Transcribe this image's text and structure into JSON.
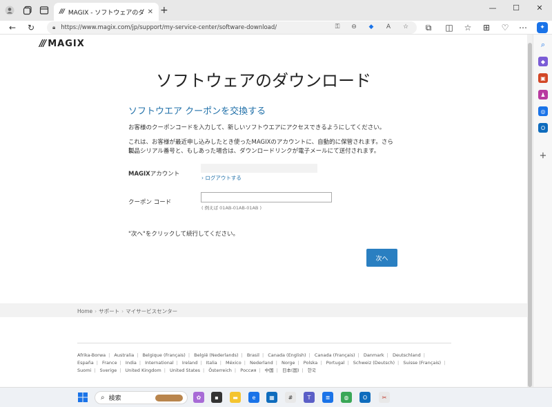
{
  "browser": {
    "tab_title": "MAGIX - ソフトウェアのダウンロード",
    "tab_favicon": "///",
    "url": "https://www.magix.com/jp/support/my-service-center/software-download/"
  },
  "page": {
    "logo": "MAGIX",
    "logo_mark": "///",
    "heading": "ソフトウェアのダウンロード",
    "subheading": "ソフトウエア クーポンを交換する",
    "intro": "お客様のクーポンコードを入力して、新しいソフトウエアにアクセスできるようにしてください。",
    "note_line1": "これは、お客様が最近申し込みしたとき使ったMAGIXのアカウントに、自動的に保管されます。さらに、",
    "note_line2": "製品シリアル番号と、もしあった場合は、ダウンロードリンクが電子メールにて送付されます。",
    "account_label_bold": "MAGIX",
    "account_label_rest": "アカウント",
    "logout_link": "ログアウトする",
    "coupon_label": "クーポン コード",
    "coupon_value": "",
    "coupon_hint": "( 例えば 01AB-01AB-01AB )",
    "instruction": "\"次へ\"をクリックして続行してください。",
    "next_button": "次へ",
    "breadcrumb": [
      "Home",
      "サポート",
      "マイサービスセンター"
    ],
    "countries": [
      "Afrika-Borwa",
      "Australia",
      "Belgique (Français)",
      "België (Nederlands)",
      "Brasil",
      "Canada (English)",
      "Canada (Français)",
      "Danmark",
      "Deutschland",
      "España",
      "France",
      "India",
      "International",
      "Ireland",
      "Italia",
      "México",
      "Nederland",
      "Norge",
      "Polska",
      "Portugal",
      "Schweiz (Deutsch)",
      "Suisse (Français)",
      "Suomi",
      "Sverige",
      "United Kingdom",
      "United States",
      "Österreich",
      "Россия",
      "中国",
      "日本(国)",
      "한국"
    ]
  },
  "taskbar": {
    "search_label": "検索"
  },
  "colors": {
    "accent_blue": "#1f6fa8",
    "button_blue": "#2a7fc1"
  }
}
